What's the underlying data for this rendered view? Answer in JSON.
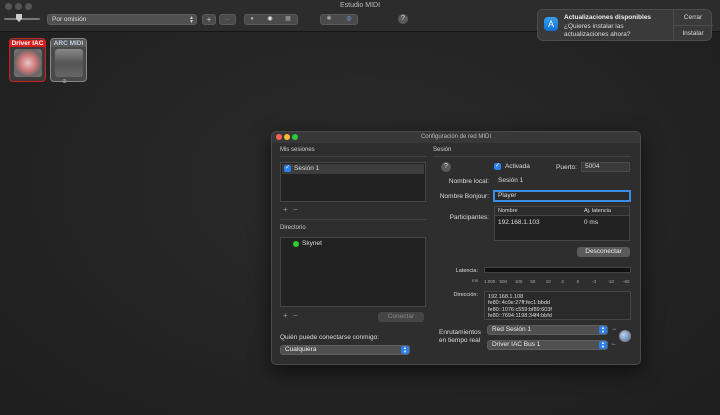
{
  "app": {
    "title": "Estudio MIDI"
  },
  "toolbar": {
    "view_select": "Por omisión",
    "add_label": "+",
    "remove_label": "−",
    "help_label": "?"
  },
  "devices": [
    {
      "name": "Driver IAC",
      "color": "#d71e1e"
    },
    {
      "name": "ARC MIDI",
      "color": "#6a6a6a"
    }
  ],
  "notification": {
    "title": "Actualizaciones disponibles",
    "body": "¿Quieres instalar las actualizaciones ahora?",
    "close_label": "Cerrar",
    "install_label": "Instalar"
  },
  "dialog": {
    "title": "Configuración de red MIDI",
    "my_sessions_header": "Mis sesiones",
    "sessions": [
      "Sesión 1"
    ],
    "directory_header": "Directorio",
    "directory_items": [
      "Skynet"
    ],
    "connect_label": "Conectar",
    "who_can_connect_label": "Quién puede conectarse conmigo:",
    "who_can_connect_value": "Cualquiera",
    "session_header": "Sesión",
    "enabled_label": "Activada",
    "port_label": "Puerto:",
    "port_value": "5004",
    "local_name_label": "Nombre local:",
    "local_name_value": "Sesión 1",
    "bonjour_name_label": "Nombre Bonjour:",
    "bonjour_name_value": "Player",
    "participants_label": "Participantes:",
    "participants_columns": [
      "Nombre",
      "Aj. latencia"
    ],
    "participants": [
      {
        "name": "192.168.1.103",
        "latency": "0 ms"
      }
    ],
    "disconnect_label": "Desconectar",
    "latency_label": "Latencia:",
    "latency_unit": "ms",
    "latency_scale": [
      "1.000",
      "500",
      "100",
      "50",
      "10",
      "3",
      "0",
      "-3",
      "-10",
      "-60"
    ],
    "address_label": "Dirección:",
    "addresses": [
      "192.168.1.108",
      "fe80::4c0e:27ff:fec1:bbdd",
      "fe80::1076:c559:bf89:603f",
      "fe80::7694:1198:34f4:bbfd"
    ],
    "routing_label_1": "Enrutamientos",
    "routing_label_2": "en tiempo real",
    "route_out": "Red Sesión 1",
    "route_in": "Driver IAC Bus 1"
  }
}
